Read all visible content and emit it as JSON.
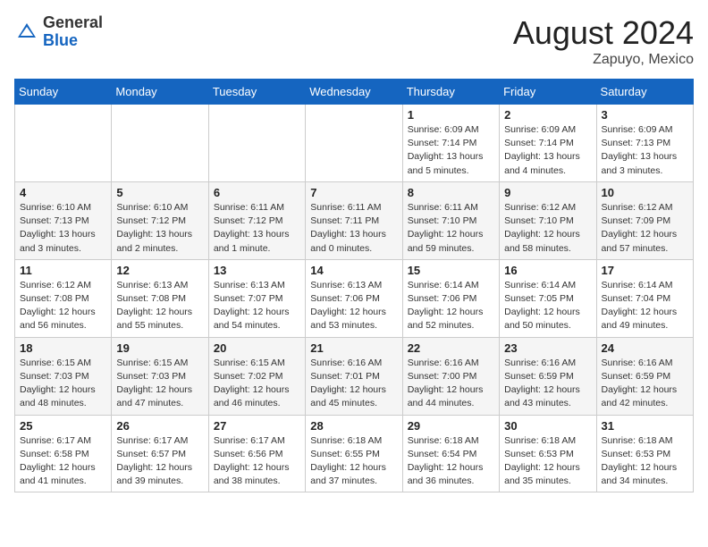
{
  "header": {
    "logo_general": "General",
    "logo_blue": "Blue",
    "month_year": "August 2024",
    "location": "Zapuyo, Mexico"
  },
  "days_of_week": [
    "Sunday",
    "Monday",
    "Tuesday",
    "Wednesday",
    "Thursday",
    "Friday",
    "Saturday"
  ],
  "weeks": [
    [
      {
        "day": "",
        "info": ""
      },
      {
        "day": "",
        "info": ""
      },
      {
        "day": "",
        "info": ""
      },
      {
        "day": "",
        "info": ""
      },
      {
        "day": "1",
        "info": "Sunrise: 6:09 AM\nSunset: 7:14 PM\nDaylight: 13 hours\nand 5 minutes."
      },
      {
        "day": "2",
        "info": "Sunrise: 6:09 AM\nSunset: 7:14 PM\nDaylight: 13 hours\nand 4 minutes."
      },
      {
        "day": "3",
        "info": "Sunrise: 6:09 AM\nSunset: 7:13 PM\nDaylight: 13 hours\nand 3 minutes."
      }
    ],
    [
      {
        "day": "4",
        "info": "Sunrise: 6:10 AM\nSunset: 7:13 PM\nDaylight: 13 hours\nand 3 minutes."
      },
      {
        "day": "5",
        "info": "Sunrise: 6:10 AM\nSunset: 7:12 PM\nDaylight: 13 hours\nand 2 minutes."
      },
      {
        "day": "6",
        "info": "Sunrise: 6:11 AM\nSunset: 7:12 PM\nDaylight: 13 hours\nand 1 minute."
      },
      {
        "day": "7",
        "info": "Sunrise: 6:11 AM\nSunset: 7:11 PM\nDaylight: 13 hours\nand 0 minutes."
      },
      {
        "day": "8",
        "info": "Sunrise: 6:11 AM\nSunset: 7:10 PM\nDaylight: 12 hours\nand 59 minutes."
      },
      {
        "day": "9",
        "info": "Sunrise: 6:12 AM\nSunset: 7:10 PM\nDaylight: 12 hours\nand 58 minutes."
      },
      {
        "day": "10",
        "info": "Sunrise: 6:12 AM\nSunset: 7:09 PM\nDaylight: 12 hours\nand 57 minutes."
      }
    ],
    [
      {
        "day": "11",
        "info": "Sunrise: 6:12 AM\nSunset: 7:08 PM\nDaylight: 12 hours\nand 56 minutes."
      },
      {
        "day": "12",
        "info": "Sunrise: 6:13 AM\nSunset: 7:08 PM\nDaylight: 12 hours\nand 55 minutes."
      },
      {
        "day": "13",
        "info": "Sunrise: 6:13 AM\nSunset: 7:07 PM\nDaylight: 12 hours\nand 54 minutes."
      },
      {
        "day": "14",
        "info": "Sunrise: 6:13 AM\nSunset: 7:06 PM\nDaylight: 12 hours\nand 53 minutes."
      },
      {
        "day": "15",
        "info": "Sunrise: 6:14 AM\nSunset: 7:06 PM\nDaylight: 12 hours\nand 52 minutes."
      },
      {
        "day": "16",
        "info": "Sunrise: 6:14 AM\nSunset: 7:05 PM\nDaylight: 12 hours\nand 50 minutes."
      },
      {
        "day": "17",
        "info": "Sunrise: 6:14 AM\nSunset: 7:04 PM\nDaylight: 12 hours\nand 49 minutes."
      }
    ],
    [
      {
        "day": "18",
        "info": "Sunrise: 6:15 AM\nSunset: 7:03 PM\nDaylight: 12 hours\nand 48 minutes."
      },
      {
        "day": "19",
        "info": "Sunrise: 6:15 AM\nSunset: 7:03 PM\nDaylight: 12 hours\nand 47 minutes."
      },
      {
        "day": "20",
        "info": "Sunrise: 6:15 AM\nSunset: 7:02 PM\nDaylight: 12 hours\nand 46 minutes."
      },
      {
        "day": "21",
        "info": "Sunrise: 6:16 AM\nSunset: 7:01 PM\nDaylight: 12 hours\nand 45 minutes."
      },
      {
        "day": "22",
        "info": "Sunrise: 6:16 AM\nSunset: 7:00 PM\nDaylight: 12 hours\nand 44 minutes."
      },
      {
        "day": "23",
        "info": "Sunrise: 6:16 AM\nSunset: 6:59 PM\nDaylight: 12 hours\nand 43 minutes."
      },
      {
        "day": "24",
        "info": "Sunrise: 6:16 AM\nSunset: 6:59 PM\nDaylight: 12 hours\nand 42 minutes."
      }
    ],
    [
      {
        "day": "25",
        "info": "Sunrise: 6:17 AM\nSunset: 6:58 PM\nDaylight: 12 hours\nand 41 minutes."
      },
      {
        "day": "26",
        "info": "Sunrise: 6:17 AM\nSunset: 6:57 PM\nDaylight: 12 hours\nand 39 minutes."
      },
      {
        "day": "27",
        "info": "Sunrise: 6:17 AM\nSunset: 6:56 PM\nDaylight: 12 hours\nand 38 minutes."
      },
      {
        "day": "28",
        "info": "Sunrise: 6:18 AM\nSunset: 6:55 PM\nDaylight: 12 hours\nand 37 minutes."
      },
      {
        "day": "29",
        "info": "Sunrise: 6:18 AM\nSunset: 6:54 PM\nDaylight: 12 hours\nand 36 minutes."
      },
      {
        "day": "30",
        "info": "Sunrise: 6:18 AM\nSunset: 6:53 PM\nDaylight: 12 hours\nand 35 minutes."
      },
      {
        "day": "31",
        "info": "Sunrise: 6:18 AM\nSunset: 6:53 PM\nDaylight: 12 hours\nand 34 minutes."
      }
    ]
  ]
}
